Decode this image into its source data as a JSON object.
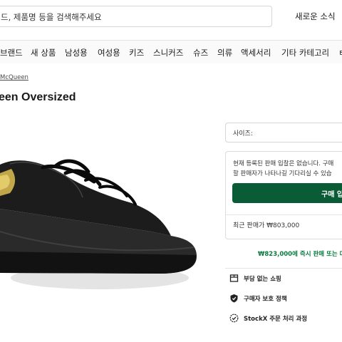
{
  "header": {
    "search_text": "드, 제품명 등을 검색해주세요",
    "new_release_link": "새로운 소식"
  },
  "nav": {
    "items": [
      "브랜드",
      "새 상품",
      "남성용",
      "여성용",
      "키즈",
      "스니커즈",
      "슈즈",
      "의류",
      "액세서리",
      "기타 카테고리"
    ]
  },
  "product": {
    "breadcrumb": "McQueen",
    "title": "een Oversized"
  },
  "purchase": {
    "size_label": "사이즈:",
    "no_listing_message": "현재 등록된 판매 입찰은 없습니다. 구매",
    "wait_message": "할 판매자가 나타나길 기다리실 수 있습",
    "buy_button": "구매 입",
    "last_sale": "최근 판매가 ₩803,000",
    "offer_line": "₩823,000에 즉시 판매 또는 다",
    "accent_color": "#0a5c36"
  },
  "features": [
    {
      "icon": "shipping-box-icon",
      "label": "부담 없는 쇼핑"
    },
    {
      "icon": "shield-check-icon",
      "label": "구매자 보호 정책"
    },
    {
      "icon": "verified-check-icon",
      "label": "StockX 주문 처리 과정"
    }
  ]
}
